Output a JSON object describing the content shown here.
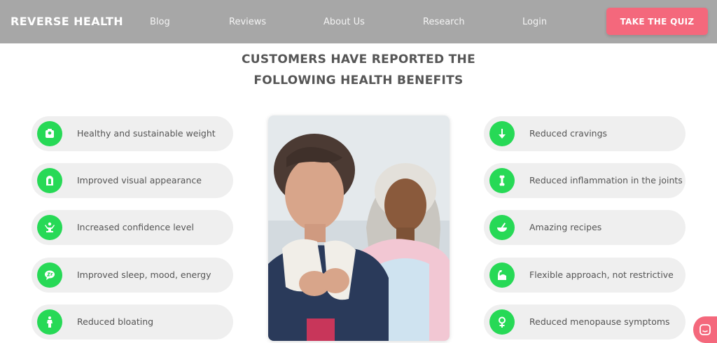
{
  "nav": {
    "brand": "REVERSE HEALTH",
    "links": [
      "Blog",
      "Reviews",
      "About Us",
      "Research",
      "Login"
    ],
    "cta": "TAKE THE QUIZ"
  },
  "heading": {
    "line1": "CUSTOMERS HAVE REPORTED THE",
    "line2": "FOLLOWING HEALTH BENEFITS"
  },
  "benefits_left": [
    {
      "label": "Healthy and sustainable weight",
      "icon": "scale-icon"
    },
    {
      "label": "Improved visual appearance",
      "icon": "mirror-icon"
    },
    {
      "label": "Increased confidence level",
      "icon": "person-raised-arms-icon"
    },
    {
      "label": "Improved sleep, mood, energy",
      "icon": "sleep-bubble-icon"
    },
    {
      "label": "Reduced bloating",
      "icon": "body-icon"
    }
  ],
  "benefits_right": [
    {
      "label": "Reduced cravings",
      "icon": "arrow-down-icon"
    },
    {
      "label": "Reduced inflammation in the joints",
      "icon": "bone-icon"
    },
    {
      "label": "Amazing recipes",
      "icon": "bowl-icon"
    },
    {
      "label": "Flexible approach, not restrictive",
      "icon": "flexed-arm-icon"
    },
    {
      "label": "Reduced menopause symptoms",
      "icon": "female-symbol-icon"
    }
  ],
  "colors": {
    "nav_bg": "#a7a7a7",
    "cta_bg": "#f4687c",
    "icon_green": "#27d956",
    "pill_bg": "#efefef"
  }
}
